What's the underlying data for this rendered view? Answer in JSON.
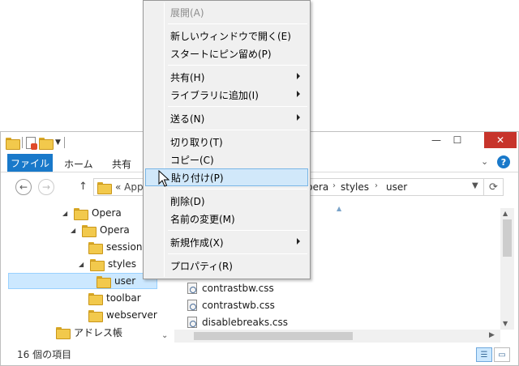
{
  "window": {
    "controls": {
      "minimize": "—",
      "maximize": "☐",
      "close": "✕"
    },
    "ribbon": {
      "file_tab": "ファイル",
      "tabs": [
        "ホーム",
        "共有"
      ],
      "help": "?"
    },
    "nav": {
      "back": "←",
      "forward": "→",
      "up": "↑",
      "address_prefix": "« App",
      "path": [
        "pera",
        "styles",
        "user"
      ],
      "refresh": "⟳"
    },
    "tree": [
      {
        "label": "Opera",
        "indent": 1,
        "expanded": true
      },
      {
        "label": "Opera",
        "indent": 2,
        "expanded": true
      },
      {
        "label": "sessions",
        "indent": 3,
        "expanded": false
      },
      {
        "label": "styles",
        "indent": 3,
        "expanded": true
      },
      {
        "label": "user",
        "indent": 4,
        "expanded": false,
        "selected": true
      },
      {
        "label": "toolbar",
        "indent": 3,
        "expanded": false
      },
      {
        "label": "webserver",
        "indent": 3,
        "expanded": false
      },
      {
        "label": "アドレス帳",
        "indent": 2,
        "expanded": false
      }
    ],
    "files": [
      "contrastbw.css",
      "contrastwb.css",
      "disablebreaks.css"
    ],
    "status": {
      "item_count": "16 個の項目"
    }
  },
  "context_menu": {
    "items": [
      {
        "label": "展開(A)",
        "disabled": true
      },
      {
        "sep": true
      },
      {
        "label": "新しいウィンドウで開く(E)"
      },
      {
        "label": "スタートにピン留め(P)"
      },
      {
        "sep": true
      },
      {
        "label": "共有(H)",
        "submenu": true
      },
      {
        "label": "ライブラリに追加(I)",
        "submenu": true
      },
      {
        "sep": true
      },
      {
        "label": "送る(N)",
        "submenu": true
      },
      {
        "sep": true
      },
      {
        "label": "切り取り(T)"
      },
      {
        "label": "コピー(C)"
      },
      {
        "label": "貼り付け(P)",
        "highlighted": true
      },
      {
        "sep": true
      },
      {
        "label": "削除(D)"
      },
      {
        "label": "名前の変更(M)"
      },
      {
        "sep": true
      },
      {
        "label": "新規作成(X)",
        "submenu": true
      },
      {
        "sep": true
      },
      {
        "label": "プロパティ(R)"
      }
    ]
  },
  "colors": {
    "accent": "#1979ca",
    "selection": "#cce8ff",
    "close_button": "#c7342b",
    "menu_highlight": "#d1e8fa"
  }
}
